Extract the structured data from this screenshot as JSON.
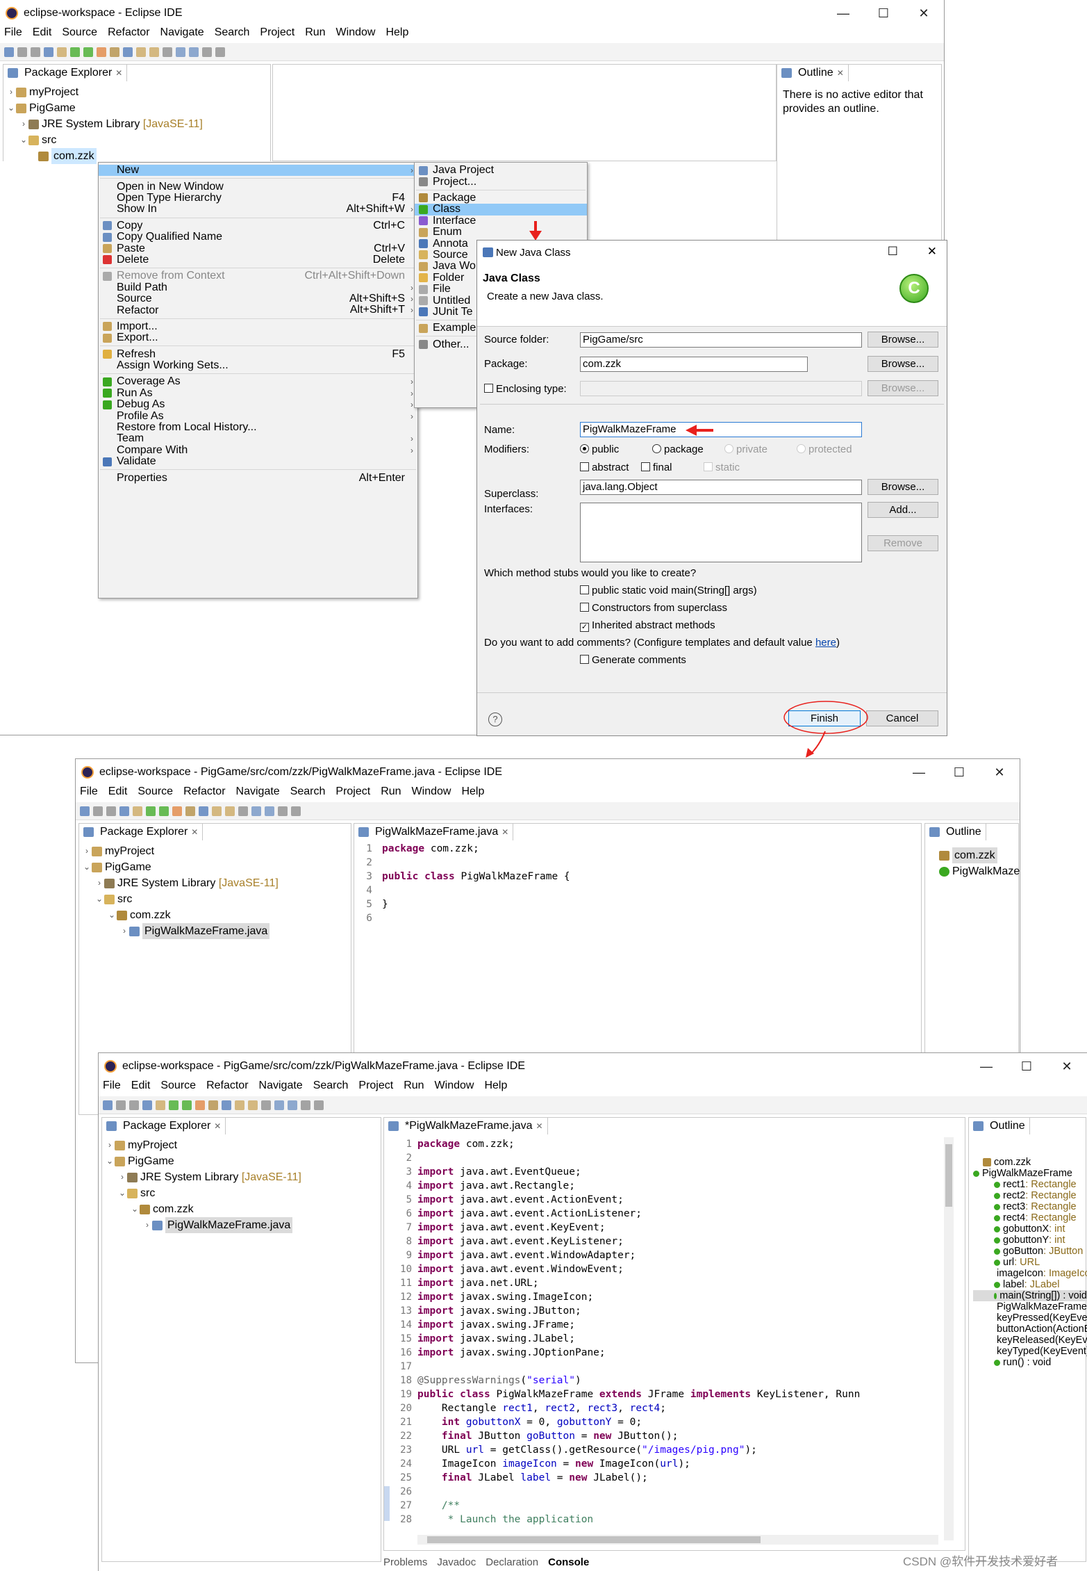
{
  "colors": {
    "selection": "#91c9f7",
    "keyword": "#7f0055",
    "string": "#2a00ff",
    "field": "#0000c0",
    "comment": "#3f7f5f",
    "annotation_red": "#e8211d",
    "type_muted": "#a8802a"
  },
  "w1": {
    "title": "eclipse-workspace - Eclipse IDE",
    "menu": [
      "File",
      "Edit",
      "Source",
      "Refactor",
      "Navigate",
      "Search",
      "Project",
      "Run",
      "Window",
      "Help"
    ],
    "explorer_tab": "Package Explorer",
    "tree": {
      "myProject": "myProject",
      "pig": "PigGame",
      "jre": "JRE System Library",
      "jre_ver": "[JavaSE-11]",
      "src": "src",
      "pkg": "com.zzk"
    },
    "outline_tab": "Outline",
    "outline_msg": "There is no active editor that provides an outline."
  },
  "ctx": {
    "items": [
      {
        "label": "New",
        "sc": "",
        "sub": true,
        "hl": true,
        "icon": ""
      },
      {
        "sep": true
      },
      {
        "label": "Open in New Window",
        "sc": "",
        "sub": false,
        "icon": ""
      },
      {
        "label": "Open Type Hierarchy",
        "sc": "F4",
        "sub": false,
        "icon": ""
      },
      {
        "label": "Show In",
        "sc": "Alt+Shift+W",
        "sub": true,
        "icon": ""
      },
      {
        "sep": true
      },
      {
        "label": "Copy",
        "sc": "Ctrl+C",
        "sub": false,
        "icon": "copy-icon"
      },
      {
        "label": "Copy Qualified Name",
        "sc": "",
        "sub": false,
        "icon": "copy-qualified-icon"
      },
      {
        "label": "Paste",
        "sc": "Ctrl+V",
        "sub": false,
        "icon": "paste-icon"
      },
      {
        "label": "Delete",
        "sc": "Delete",
        "sub": false,
        "icon": "delete-icon"
      },
      {
        "sep": true
      },
      {
        "label": "Remove from Context",
        "sc": "Ctrl+Alt+Shift+Down",
        "sub": false,
        "dis": true,
        "icon": "remove-context-icon"
      },
      {
        "label": "Build Path",
        "sc": "",
        "sub": true,
        "icon": ""
      },
      {
        "label": "Source",
        "sc": "Alt+Shift+S",
        "sub": true,
        "icon": ""
      },
      {
        "label": "Refactor",
        "sc": "Alt+Shift+T",
        "sub": true,
        "icon": ""
      },
      {
        "sep": true
      },
      {
        "label": "Import...",
        "sc": "",
        "sub": false,
        "icon": "import-icon"
      },
      {
        "label": "Export...",
        "sc": "",
        "sub": false,
        "icon": "export-icon"
      },
      {
        "sep": true
      },
      {
        "label": "Refresh",
        "sc": "F5",
        "sub": false,
        "icon": "refresh-icon"
      },
      {
        "label": "Assign Working Sets...",
        "sc": "",
        "sub": false,
        "icon": ""
      },
      {
        "sep": true
      },
      {
        "label": "Coverage As",
        "sc": "",
        "sub": true,
        "icon": "coverage-icon"
      },
      {
        "label": "Run As",
        "sc": "",
        "sub": true,
        "icon": "run-icon"
      },
      {
        "label": "Debug As",
        "sc": "",
        "sub": true,
        "icon": "debug-icon"
      },
      {
        "label": "Profile As",
        "sc": "",
        "sub": true,
        "icon": ""
      },
      {
        "label": "Restore from Local History...",
        "sc": "",
        "sub": false,
        "icon": ""
      },
      {
        "label": "Team",
        "sc": "",
        "sub": true,
        "icon": ""
      },
      {
        "label": "Compare With",
        "sc": "",
        "sub": true,
        "icon": ""
      },
      {
        "label": "Validate",
        "sc": "",
        "sub": false,
        "icon": "validate-icon"
      },
      {
        "sep": true
      },
      {
        "label": "Properties",
        "sc": "Alt+Enter",
        "sub": false,
        "icon": ""
      }
    ]
  },
  "submenu": {
    "items": [
      {
        "label": "Java Project",
        "icon": "java-project-icon"
      },
      {
        "label": "Project...",
        "icon": "project-icon"
      },
      {
        "sep": true
      },
      {
        "label": "Package",
        "icon": "package-icon"
      },
      {
        "label": "Class",
        "icon": "class-icon",
        "hl": true
      },
      {
        "label": "Interface",
        "icon": "interface-icon"
      },
      {
        "label": "Enum",
        "icon": "enum-icon"
      },
      {
        "label": "Annota",
        "icon": "annotation-icon"
      },
      {
        "label": "Source",
        "icon": "source-folder-icon"
      },
      {
        "label": "Java Wo",
        "icon": "java-working-set-icon"
      },
      {
        "label": "Folder",
        "icon": "folder-icon"
      },
      {
        "label": "File",
        "icon": "file-icon"
      },
      {
        "label": "Untitled",
        "icon": "untitled-icon"
      },
      {
        "label": "JUnit Te",
        "icon": "junit-icon"
      },
      {
        "sep": true
      },
      {
        "label": "Example",
        "icon": "example-icon"
      },
      {
        "sep": true
      },
      {
        "label": "Other...",
        "icon": "other-icon"
      }
    ]
  },
  "dlg": {
    "title": "New Java Class",
    "heading": "Java Class",
    "desc": "Create a new Java class.",
    "source_folder_label": "Source folder:",
    "source_folder": "PigGame/src",
    "package_label": "Package:",
    "package": "com.zzk",
    "enclosing_label": "Enclosing type:",
    "name_label": "Name:",
    "name": "PigWalkMazeFrame",
    "modifiers_label": "Modifiers:",
    "public": "public",
    "package_mod": "package",
    "private": "private",
    "protected": "protected",
    "abstract": "abstract",
    "final": "final",
    "static": "static",
    "superclass_label": "Superclass:",
    "superclass": "java.lang.Object",
    "interfaces_label": "Interfaces:",
    "browse": "Browse...",
    "add": "Add...",
    "remove": "Remove",
    "stubs_q": "Which method stubs would you like to create?",
    "stub_main": "public static void main(String[] args)",
    "stub_ctor": "Constructors from superclass",
    "stub_inh": "Inherited abstract methods",
    "comments_q": "Do you want to add comments? (Configure templates and default value",
    "here": "here",
    "gen_comments": "Generate comments",
    "finish": "Finish",
    "cancel": "Cancel"
  },
  "w2": {
    "title": "eclipse-workspace - PigGame/src/com/zzk/PigWalkMazeFrame.java - Eclipse IDE",
    "menu": [
      "File",
      "Edit",
      "Source",
      "Refactor",
      "Navigate",
      "Search",
      "Project",
      "Run",
      "Window",
      "Help"
    ],
    "explorer_tab": "Package Explorer",
    "editor_tab": "PigWalkMazeFrame.java",
    "outline_tab": "Outline",
    "file": "PigWalkMazeFrame.java",
    "outline_pkg": "com.zzk",
    "outline_class": "PigWalkMazeFrame"
  },
  "w3": {
    "title": "eclipse-workspace - PigGame/src/com/zzk/PigWalkMazeFrame.java - Eclipse IDE",
    "menu": [
      "File",
      "Edit",
      "Source",
      "Refactor",
      "Navigate",
      "Search",
      "Project",
      "Run",
      "Window",
      "Help"
    ],
    "explorer_tab": "Package Explorer",
    "editor_tab": "*PigWalkMazeFrame.java",
    "outline_tab": "Outline",
    "bottom_tabs": [
      "Problems",
      "Javadoc",
      "Declaration",
      "Console"
    ],
    "outline": [
      {
        "name": "com.zzk",
        "type": "",
        "indent": 0,
        "icon": "package-icon"
      },
      {
        "name": "PigWalkMazeFrame",
        "type": "",
        "indent": 0,
        "icon": "class-icon"
      },
      {
        "name": "rect1",
        "type": " : Rectangle",
        "indent": 1,
        "icon": "field-icon"
      },
      {
        "name": "rect2",
        "type": " : Rectangle",
        "indent": 1,
        "icon": "field-icon"
      },
      {
        "name": "rect3",
        "type": " : Rectangle",
        "indent": 1,
        "icon": "field-icon"
      },
      {
        "name": "rect4",
        "type": " : Rectangle",
        "indent": 1,
        "icon": "field-icon"
      },
      {
        "name": "gobuttonX",
        "type": " : int",
        "indent": 1,
        "icon": "field-icon"
      },
      {
        "name": "gobuttonY",
        "type": " : int",
        "indent": 1,
        "icon": "field-icon"
      },
      {
        "name": "goButton",
        "type": " : JButton",
        "indent": 1,
        "icon": "field-icon"
      },
      {
        "name": "url",
        "type": " : URL",
        "indent": 1,
        "icon": "field-icon"
      },
      {
        "name": "imageIcon",
        "type": " : ImageIcon",
        "indent": 1,
        "icon": "field-icon"
      },
      {
        "name": "label",
        "type": " : JLabel",
        "indent": 1,
        "icon": "field-icon"
      },
      {
        "name": "main(String[]) : void",
        "type": "",
        "indent": 1,
        "icon": "method-icon",
        "hl": true
      },
      {
        "name": "PigWalkMazeFrame()",
        "type": "",
        "indent": 1,
        "icon": "constructor-icon"
      },
      {
        "name": "keyPressed(KeyEvent) :",
        "type": "",
        "indent": 1,
        "icon": "method-icon"
      },
      {
        "name": "buttonAction(ActionEv",
        "type": "",
        "indent": 1,
        "icon": "method-icon"
      },
      {
        "name": "keyReleased(KeyEvent)",
        "type": "",
        "indent": 1,
        "icon": "method-icon"
      },
      {
        "name": "keyTyped(KeyEvent) : v",
        "type": "",
        "indent": 1,
        "icon": "method-icon"
      },
      {
        "name": "run() : void",
        "type": "",
        "indent": 1,
        "icon": "method-icon"
      }
    ]
  },
  "watermark": "CSDN @软件开发技术爱好者"
}
